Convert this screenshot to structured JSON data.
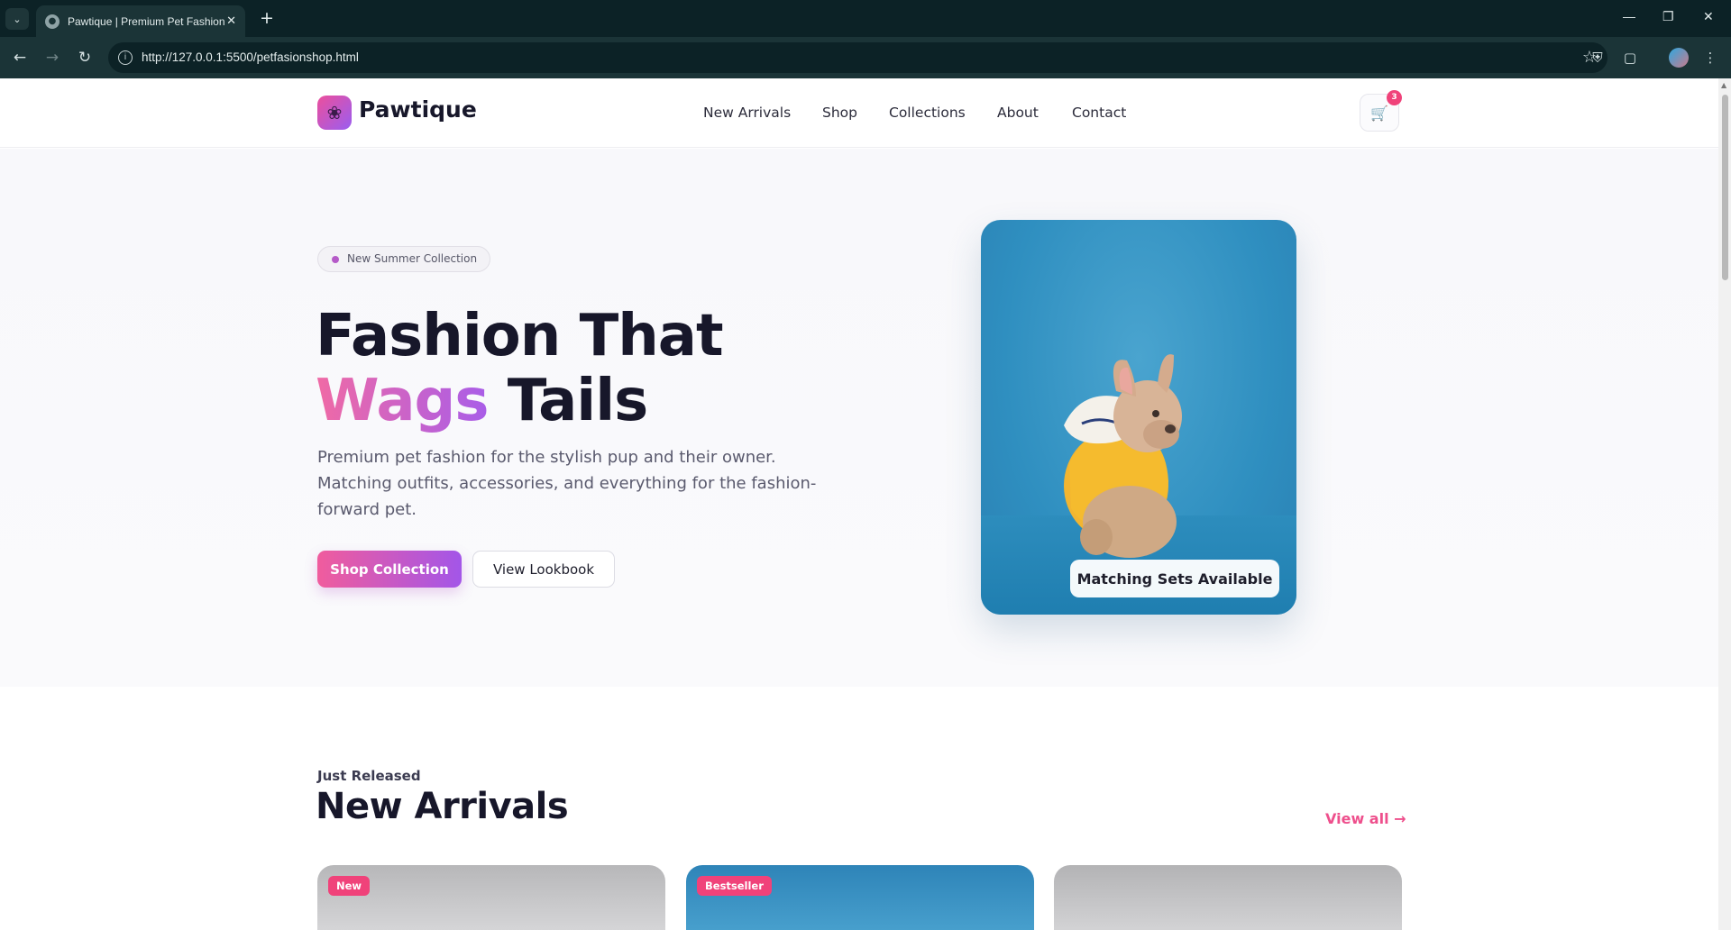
{
  "browser": {
    "tab_title": "Pawtique | Premium Pet Fashion",
    "url": "http://127.0.0.1:5500/petfasionshop.html"
  },
  "site": {
    "brand": "Pawtique",
    "nav": [
      "New Arrivals",
      "Shop",
      "Collections",
      "About",
      "Contact"
    ],
    "cart_count": "3"
  },
  "hero": {
    "badge": "New Summer Collection",
    "title_line1": "Fashion That",
    "title_word_accent": "Wags",
    "title_word_rest": "Tails",
    "subtitle": "Premium pet fashion for the stylish pup and their owner. Matching outfits, accessories, and everything for the fashion-forward pet.",
    "primary_cta": "Shop Collection",
    "secondary_cta": "View Lookbook",
    "card_caption": "Matching Sets Available"
  },
  "arrivals": {
    "kicker": "Just Released",
    "title": "New Arrivals",
    "view_all": "View all →",
    "cards": [
      {
        "label": "New"
      },
      {
        "label": "Bestseller"
      },
      {
        "label": ""
      }
    ]
  },
  "colors": {
    "accent_pink": "#f0427a",
    "accent_purple": "#a356e8",
    "hero_card_blue": "#2f8fc0",
    "browser_frame": "#0c2226"
  }
}
